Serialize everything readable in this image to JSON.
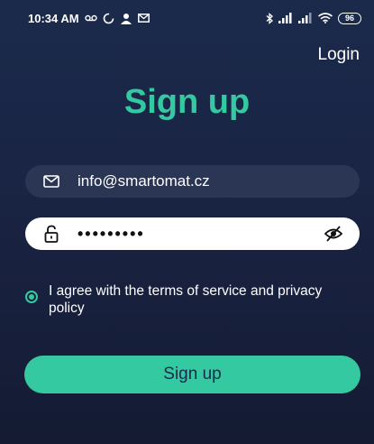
{
  "status_bar": {
    "time": "10:34 AM",
    "battery": "96",
    "icons": [
      "voicemail-icon",
      "sync-icon",
      "user-alert-icon",
      "mail-icon",
      "bluetooth-icon",
      "signal-icon",
      "signal-icon",
      "wifi-icon",
      "battery-icon"
    ]
  },
  "header": {
    "login_label": "Login"
  },
  "form": {
    "title": "Sign up",
    "email_value": "info@smartomat.cz",
    "password_value": "•••••••••",
    "terms_label": "I agree with the terms of service and privacy policy",
    "terms_checked": true,
    "submit_label": "Sign up"
  },
  "colors": {
    "accent": "#34c9a0",
    "background": "#1b2a4b",
    "field_dark": "#2b3654",
    "field_light": "#ffffff"
  }
}
